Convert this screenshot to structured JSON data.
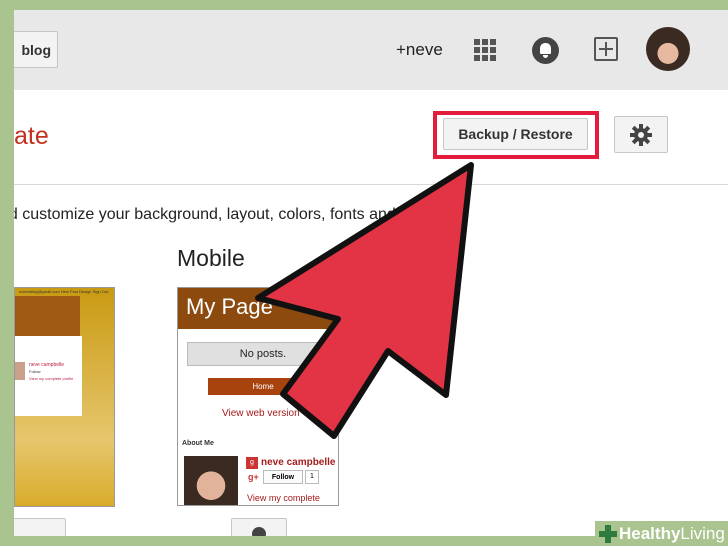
{
  "header": {
    "blog_button": "blog",
    "account_label": "+neve",
    "icons": [
      "apps-grid-icon",
      "notifications-bell-icon",
      "add-post-icon",
      "profile-avatar-icon"
    ]
  },
  "page": {
    "title_fragment": "ate",
    "backup_button": "Backup / Restore",
    "description": "nd customize your background, layout, colors, fonts and more...",
    "mobile_heading": "Mobile"
  },
  "desktop_preview": {
    "email_text": "ndemiaing@gmail.com New Post Design Sign Out",
    "author": "neve campbelle",
    "follow": "Follow",
    "profile_link": "View my complete profile"
  },
  "mobile_preview": {
    "blog_title": "My Page",
    "no_posts": "No posts.",
    "home_button": "Home",
    "view_web": "View web version",
    "about_me": "About Me",
    "author": "neve campbelle",
    "follow": "Follow",
    "follow_count": "1",
    "profile_link": "View my complete profile"
  },
  "colors": {
    "highlight_red": "#e31c3d",
    "title_red": "#c1311f",
    "mobile_header_brown": "#8c4a0f",
    "watermark_green": "#a9c48f"
  },
  "watermark": {
    "brand_bold": "Healthy",
    "brand_light": "Living"
  }
}
